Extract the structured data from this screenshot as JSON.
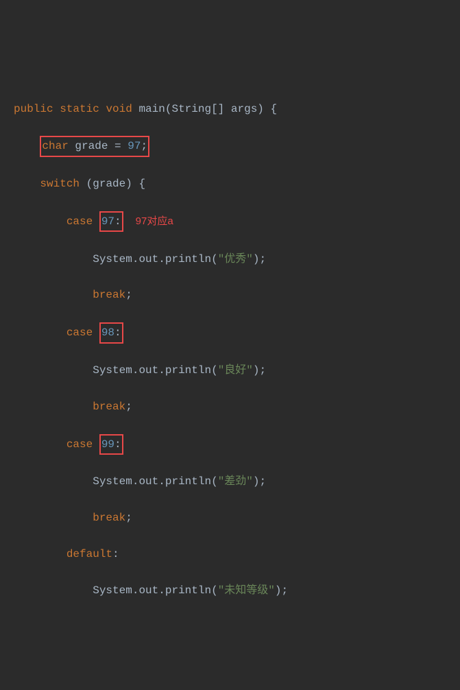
{
  "code": {
    "line1": {
      "kw1": "public",
      "kw2": "static",
      "kw3": "void",
      "method": "main",
      "cls": "String",
      "arr": "[]",
      "param": "args",
      "open": "(",
      "close": ")",
      "brace": "{"
    },
    "line2": {
      "kw": "char",
      "var": "grade",
      "eq": "=",
      "num": "97",
      "semi": ";"
    },
    "line3": {
      "kw": "switch",
      "open": "(",
      "var": "grade",
      "close": ")",
      "brace": "{"
    },
    "line4": {
      "kw": "case",
      "num": "97",
      "colon": ":"
    },
    "annot4": "97对应a",
    "line5": {
      "obj": "System",
      "dot1": ".",
      "out": "out",
      "dot2": ".",
      "method": "println",
      "open": "(",
      "str": "\"优秀\"",
      "close": ")",
      "semi": ";"
    },
    "line6": {
      "kw": "break",
      "semi": ";"
    },
    "line7": {
      "kw": "case",
      "num": "98",
      "colon": ":"
    },
    "line8": {
      "obj": "System",
      "dot1": ".",
      "out": "out",
      "dot2": ".",
      "method": "println",
      "open": "(",
      "str": "\"良好\"",
      "close": ")",
      "semi": ";"
    },
    "line9": {
      "kw": "break",
      "semi": ";"
    },
    "line10": {
      "kw": "case",
      "num": "99",
      "colon": ":"
    },
    "line11": {
      "obj": "System",
      "dot1": ".",
      "out": "out",
      "dot2": ".",
      "method": "println",
      "open": "(",
      "str": "\"差劲\"",
      "close": ")",
      "semi": ";"
    },
    "line12": {
      "kw": "break",
      "semi": ";"
    },
    "line13": {
      "kw": "default",
      "colon": ":"
    },
    "line14": {
      "obj": "System",
      "dot1": ".",
      "out": "out",
      "dot2": ".",
      "method": "println",
      "open": "(",
      "str": "\"未知等级\"",
      "close": ")",
      "semi": ";"
    }
  }
}
